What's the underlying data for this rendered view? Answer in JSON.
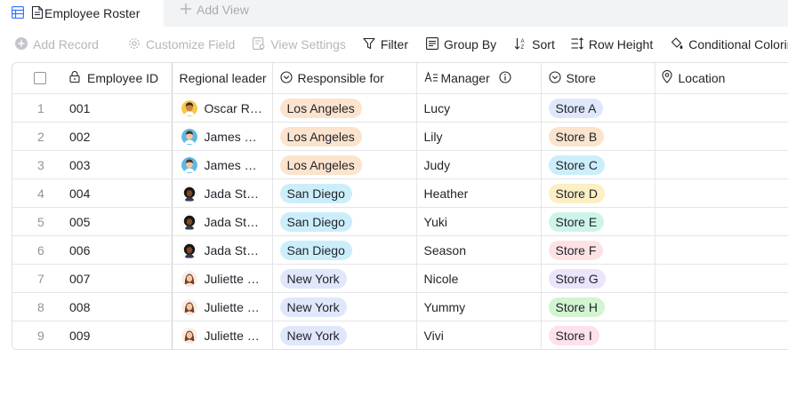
{
  "tabs": {
    "active_label": "Employee Roster",
    "add_view_label": "Add View"
  },
  "toolbar": {
    "add_record": "Add Record",
    "customize_field": "Customize Field",
    "view_settings": "View Settings",
    "filter": "Filter",
    "group_by": "Group By",
    "sort": "Sort",
    "row_height": "Row Height",
    "conditional_coloring": "Conditional Coloring"
  },
  "columns": {
    "employee_id": "Employee ID",
    "regional_leader": "Regional leader",
    "responsible_for": "Responsible for",
    "manager": "Manager",
    "store": "Store",
    "location": "Location"
  },
  "colors": {
    "la": "#fbe3cd",
    "sd": "#cceefa",
    "ny": "#e1e7fb",
    "store_a": "#e1e7fb",
    "store_b": "#fbe3cd",
    "store_c": "#cceefa",
    "store_d": "#fcefc4",
    "store_e": "#cef4ea",
    "store_f": "#fde2e4",
    "store_g": "#ece4fb",
    "store_h": "#d3f4d1",
    "store_i": "#fde1ec"
  },
  "rows": [
    {
      "num": "1",
      "id": "001",
      "leader": "Oscar Ra...",
      "avatar_icon": "avatar-oscar-icon",
      "responsible": "Los Angeles",
      "manager": "Lucy",
      "store": "Store A",
      "location": ""
    },
    {
      "num": "2",
      "id": "002",
      "leader": "James Mo...",
      "avatar_icon": "avatar-james-icon",
      "responsible": "Los Angeles",
      "manager": "Lily",
      "store": "Store B",
      "location": ""
    },
    {
      "num": "3",
      "id": "003",
      "leader": "James Mo...",
      "avatar_icon": "avatar-james-icon",
      "responsible": "Los Angeles",
      "manager": "Judy",
      "store": "Store C",
      "location": ""
    },
    {
      "num": "4",
      "id": "004",
      "leader": "Jada Stall...",
      "avatar_icon": "avatar-jada-icon",
      "responsible": "San Diego",
      "manager": "Heather",
      "store": "Store D",
      "location": ""
    },
    {
      "num": "5",
      "id": "005",
      "leader": "Jada Stall...",
      "avatar_icon": "avatar-jada-icon",
      "responsible": "San Diego",
      "manager": "Yuki",
      "store": "Store E",
      "location": ""
    },
    {
      "num": "6",
      "id": "006",
      "leader": "Jada Stall...",
      "avatar_icon": "avatar-jada-icon",
      "responsible": "San Diego",
      "manager": "Season",
      "store": "Store F",
      "location": ""
    },
    {
      "num": "7",
      "id": "007",
      "leader": "Juliette R...",
      "avatar_icon": "avatar-juliette-icon",
      "responsible": "New York",
      "manager": "Nicole",
      "store": "Store G",
      "location": ""
    },
    {
      "num": "8",
      "id": "008",
      "leader": "Juliette R...",
      "avatar_icon": "avatar-juliette-icon",
      "responsible": "New York",
      "manager": "Yummy",
      "store": "Store H",
      "location": ""
    },
    {
      "num": "9",
      "id": "009",
      "leader": "Juliette R...",
      "avatar_icon": "avatar-juliette-icon",
      "responsible": "New York",
      "manager": "Vivi",
      "store": "Store I",
      "location": ""
    }
  ]
}
